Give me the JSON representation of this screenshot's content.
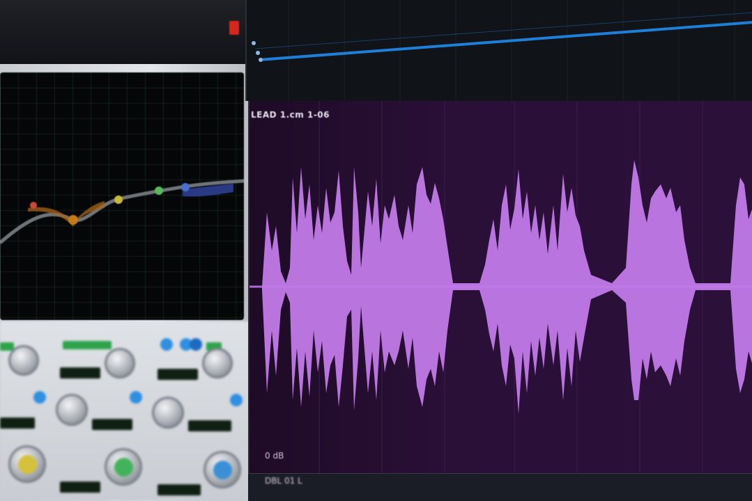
{
  "eq_plugin": {
    "close_button_color": "#d7261e",
    "display_background": "#050607",
    "curve_colors": [
      "#6a6f74",
      "#c97a1a",
      "#b9b53a",
      "#3b4fa6"
    ]
  },
  "controls": {
    "knobs": [
      {
        "name": "knob-1",
        "color": "#8d9198"
      },
      {
        "name": "knob-2",
        "color": "#8d9198"
      },
      {
        "name": "knob-3",
        "color": "#8d9198"
      },
      {
        "name": "knob-4",
        "color": "#8d9198"
      },
      {
        "name": "knob-5",
        "color": "#8d9198"
      },
      {
        "name": "knob-6",
        "color": "#8d9198"
      },
      {
        "name": "knob-yellow",
        "color": "#d4c23a"
      },
      {
        "name": "knob-green",
        "color": "#43b35b"
      },
      {
        "name": "knob-blue",
        "color": "#3b8fd6"
      }
    ]
  },
  "track": {
    "name": "LEAD 1.cm 1-06",
    "db_label": "0 dB",
    "waveform_color": "#c27ae8",
    "background_color": "#2a0f37"
  },
  "lower_track": {
    "name": "DBL 01 L"
  },
  "automation_color": "#1f7fd6"
}
